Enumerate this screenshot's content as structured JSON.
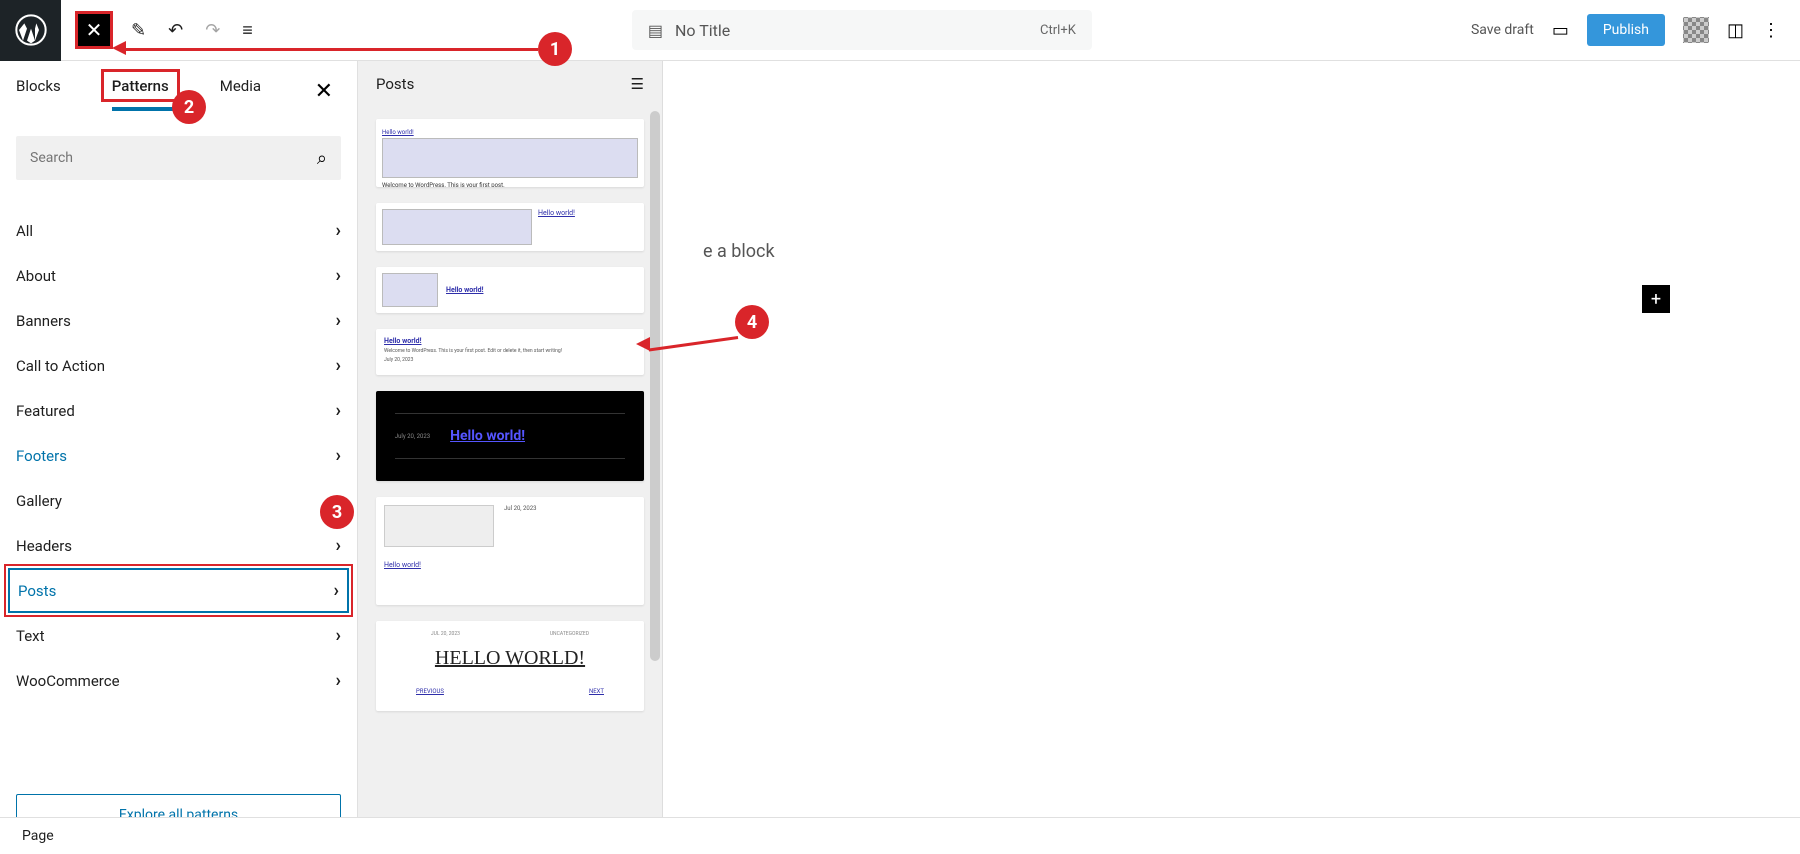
{
  "topbar": {
    "title": "No Title",
    "shortcut": "Ctrl+K",
    "save_draft": "Save draft",
    "publish": "Publish"
  },
  "tabs": {
    "blocks": "Blocks",
    "patterns": "Patterns",
    "media": "Media"
  },
  "search": {
    "placeholder": "Search"
  },
  "categories": [
    {
      "label": "All",
      "active": false
    },
    {
      "label": "About",
      "active": false
    },
    {
      "label": "Banners",
      "active": false
    },
    {
      "label": "Call to Action",
      "active": false
    },
    {
      "label": "Featured",
      "active": false
    },
    {
      "label": "Footers",
      "active": true
    },
    {
      "label": "Gallery",
      "active": false
    },
    {
      "label": "Headers",
      "active": false
    },
    {
      "label": "Posts",
      "active": true,
      "selected": true
    },
    {
      "label": "Text",
      "active": false
    },
    {
      "label": "WooCommerce",
      "active": false
    }
  ],
  "explore": "Explore all patterns",
  "preview": {
    "title": "Posts",
    "cards": {
      "c1_link": "Hello world!",
      "c2_link": "Hello world!",
      "c3_link": "Hello world!",
      "c4_link": "Hello world!",
      "c5_link": "Hello world!",
      "c6_link": "Hello world!",
      "c7_title": "HELLO WORLD!",
      "c7_prev": "PREVIOUS",
      "c7_next": "NEXT",
      "c7_date": "JUL 20, 2023",
      "c7_cat": "UNCATEGORIZED"
    }
  },
  "editor": {
    "placeholder_suffix": "e a block"
  },
  "bottom": {
    "type": "Page"
  },
  "annotations": {
    "m1": "1",
    "m2": "2",
    "m3": "3",
    "m4": "4"
  }
}
